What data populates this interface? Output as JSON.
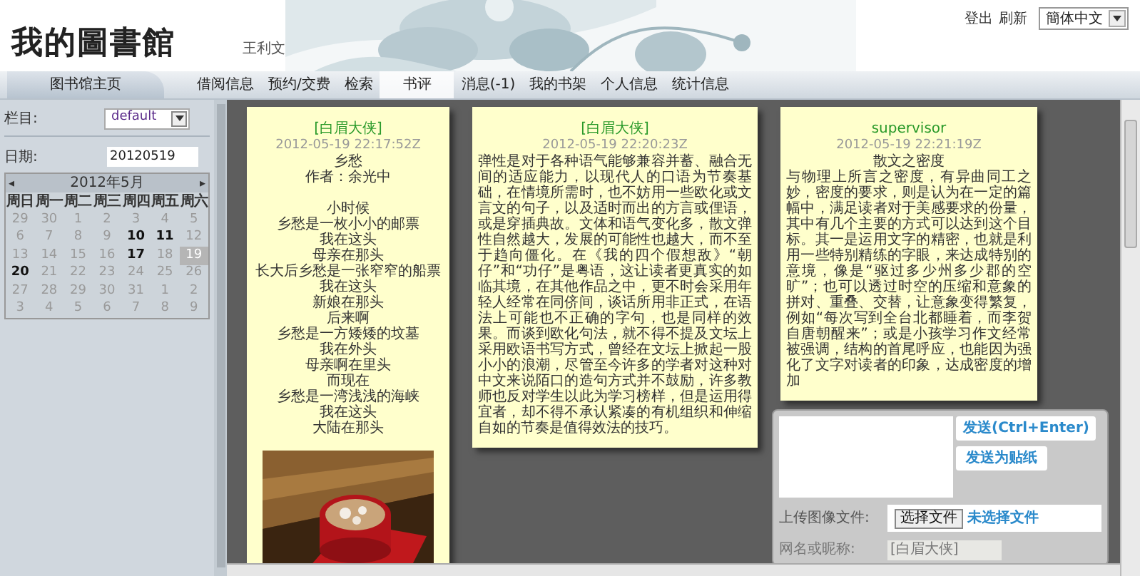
{
  "header": {
    "logo": "我的圖書館",
    "user": "王利文",
    "links": [
      "登出",
      "刷新"
    ],
    "language": "簡体中文"
  },
  "nav": {
    "home": "图书馆主页",
    "items": [
      {
        "label": "借阅信息",
        "selected": false
      },
      {
        "label": "预约/交费",
        "selected": false
      },
      {
        "label": "检索",
        "selected": false
      },
      {
        "label": "书评",
        "selected": true
      },
      {
        "label": "消息(-1)",
        "selected": false
      },
      {
        "label": "我的书架",
        "selected": false
      },
      {
        "label": "个人信息",
        "selected": false
      },
      {
        "label": "统计信息",
        "selected": false
      }
    ]
  },
  "sidebar": {
    "column_label": "栏目:",
    "column_value": "default",
    "date_label": "日期:",
    "date_value": "20120519",
    "calendar": {
      "prev": "◂",
      "month": "2012年5月",
      "next": "▸",
      "weekdays": [
        "周日",
        "周一",
        "周二",
        "周三",
        "周四",
        "周五",
        "周六"
      ],
      "days": [
        {
          "day": "29",
          "highlighted": false,
          "selected": false
        },
        {
          "day": "30",
          "highlighted": false,
          "selected": false
        },
        {
          "day": "1",
          "highlighted": false,
          "selected": false
        },
        {
          "day": "2",
          "highlighted": false,
          "selected": false
        },
        {
          "day": "3",
          "highlighted": false,
          "selected": false
        },
        {
          "day": "4",
          "highlighted": false,
          "selected": false
        },
        {
          "day": "5",
          "highlighted": false,
          "selected": false
        },
        {
          "day": "6",
          "highlighted": false,
          "selected": false
        },
        {
          "day": "7",
          "highlighted": false,
          "selected": false
        },
        {
          "day": "8",
          "highlighted": false,
          "selected": false
        },
        {
          "day": "9",
          "highlighted": false,
          "selected": false
        },
        {
          "day": "10",
          "highlighted": true,
          "selected": false
        },
        {
          "day": "11",
          "highlighted": true,
          "selected": false
        },
        {
          "day": "12",
          "highlighted": false,
          "selected": false
        },
        {
          "day": "13",
          "highlighted": false,
          "selected": false
        },
        {
          "day": "14",
          "highlighted": false,
          "selected": false
        },
        {
          "day": "15",
          "highlighted": false,
          "selected": false
        },
        {
          "day": "16",
          "highlighted": false,
          "selected": false
        },
        {
          "day": "17",
          "highlighted": true,
          "selected": false
        },
        {
          "day": "18",
          "highlighted": false,
          "selected": false
        },
        {
          "day": "19",
          "highlighted": false,
          "selected": true
        },
        {
          "day": "20",
          "highlighted": true,
          "selected": false
        },
        {
          "day": "21",
          "highlighted": false,
          "selected": false
        },
        {
          "day": "22",
          "highlighted": false,
          "selected": false
        },
        {
          "day": "23",
          "highlighted": false,
          "selected": false
        },
        {
          "day": "24",
          "highlighted": false,
          "selected": false
        },
        {
          "day": "25",
          "highlighted": false,
          "selected": false
        },
        {
          "day": "26",
          "highlighted": false,
          "selected": false
        },
        {
          "day": "27",
          "highlighted": false,
          "selected": false
        },
        {
          "day": "28",
          "highlighted": false,
          "selected": false
        },
        {
          "day": "29",
          "highlighted": false,
          "selected": false
        },
        {
          "day": "30",
          "highlighted": false,
          "selected": false
        },
        {
          "day": "31",
          "highlighted": false,
          "selected": false
        },
        {
          "day": "1",
          "highlighted": false,
          "selected": false
        },
        {
          "day": "2",
          "highlighted": false,
          "selected": false
        },
        {
          "day": "3",
          "highlighted": false,
          "selected": false
        },
        {
          "day": "4",
          "highlighted": false,
          "selected": false
        },
        {
          "day": "5",
          "highlighted": false,
          "selected": false
        },
        {
          "day": "6",
          "highlighted": false,
          "selected": false
        },
        {
          "day": "7",
          "highlighted": false,
          "selected": false
        },
        {
          "day": "8",
          "highlighted": false,
          "selected": false
        },
        {
          "day": "9",
          "highlighted": false,
          "selected": false
        }
      ]
    }
  },
  "notes": [
    {
      "author": "[白眉大侠]",
      "time": "2012-05-19 22:17:52Z",
      "lines": [
        "乡愁",
        "作者：余光中",
        "小时候",
        "乡愁是一枚小小的邮票",
        "我在这头",
        "母亲在那头",
        "长大后乡愁是一张窄窄的船票",
        "我在这头",
        "新娘在那头",
        "后来啊",
        "乡愁是一方矮矮的坟墓",
        "我在外头",
        "母亲啊在里头",
        "而现在",
        "乡愁是一湾浅浅的海峡",
        "我在这头",
        "大陆在那头"
      ],
      "kind": "picture"
    },
    {
      "author": "[白眉大侠]",
      "time": "2012-05-19 22:20:23Z",
      "lines": [
        "弹性是对于各种语气能够兼容并蓄、融合无间的适应能力，以现代人的口语为节奏基础，在情境所需时，也不妨用一些欧化或文言文的句子，以及适时而出的方言或俚语，或是穿插典故。文体和语气变化多，散文弹性自然越大，发展的可能性也越大，而不至于趋向僵化。在《我的四个假想敌》“朝仔”和“功仔”是粤语，这让读者更真实的如临其境，在其他作品之中，更不时会采用年轻人经常在同侪间，谈话所用非正式，在语法上可能也不正确的字句，也是同样的效果。而谈到欧化句法，就不得不提及文坛上采用欧语书写方式，曾经在文坛上掀起一股小小的浪潮，尽管至今许多的学者对这种对中文来说陌口的造句方式并不鼓励，许多教师也反对学生以此为学习榜样，但是运用得宜者，却不得不承认紧凑的有机组织和伸缩自如的节奏是值得效法的技巧。"
      ],
      "kind": "text"
    },
    {
      "author": "supervisor",
      "time": "2012-05-19 22:21:19Z",
      "lines": [
        "散文之密度",
        "与物理上所言之密度，有异曲同工之妙，密度的要求，则是认为在一定的篇幅中，满足读者对于美感要求的份量，其中有几个主要的方式可以达到这个目标。其一是运用文字的精密，也就是利用一些特别精练的字眼，来达成特别的意境，像是“驱过多少州多少郡的空旷”；也可以透过时空的压缩和意象的拼对、重叠、交替，让意象变得繁复，例如“每次写到全台北都睡着，而李贺自唐朝醒来”；或是小孩学习作文经常被强调，结构的首尾呼应，也能因为强化了文字对读者的印象，达成密度的增加"
      ],
      "kind": "text"
    }
  ],
  "composer": {
    "send": "发送(Ctrl+Enter)",
    "send_sticker": "发送为贴纸",
    "upload_label": "上传图像文件:",
    "choose_file": "选择文件",
    "no_file": "未选择文件",
    "name_label": "网名或昵称:",
    "name_value": "[白眉大侠]",
    "name_disabled": true
  }
}
